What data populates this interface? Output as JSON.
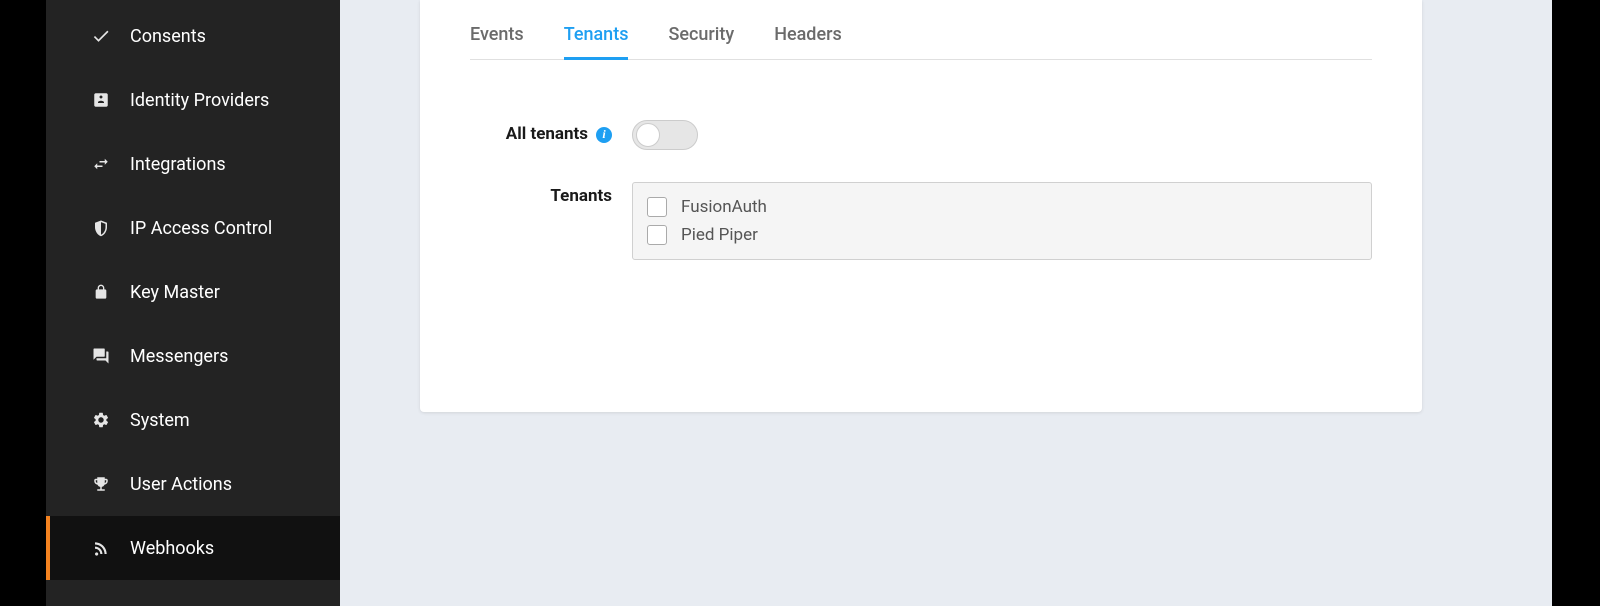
{
  "sidebar": {
    "items": [
      {
        "label": "Consents",
        "icon": "check"
      },
      {
        "label": "Identity Providers",
        "icon": "id-badge"
      },
      {
        "label": "Integrations",
        "icon": "exchange"
      },
      {
        "label": "IP Access Control",
        "icon": "shield"
      },
      {
        "label": "Key Master",
        "icon": "lock"
      },
      {
        "label": "Messengers",
        "icon": "comments"
      },
      {
        "label": "System",
        "icon": "gear"
      },
      {
        "label": "User Actions",
        "icon": "trophy"
      },
      {
        "label": "Webhooks",
        "icon": "rss",
        "active": true
      }
    ]
  },
  "tabs": [
    {
      "label": "Events",
      "active": false
    },
    {
      "label": "Tenants",
      "active": true
    },
    {
      "label": "Security",
      "active": false
    },
    {
      "label": "Headers",
      "active": false
    }
  ],
  "form": {
    "allTenantsLabel": "All tenants",
    "allTenantsOn": false,
    "tenantsLabel": "Tenants",
    "tenants": [
      {
        "name": "FusionAuth",
        "checked": false
      },
      {
        "name": "Pied Piper",
        "checked": false
      }
    ]
  }
}
